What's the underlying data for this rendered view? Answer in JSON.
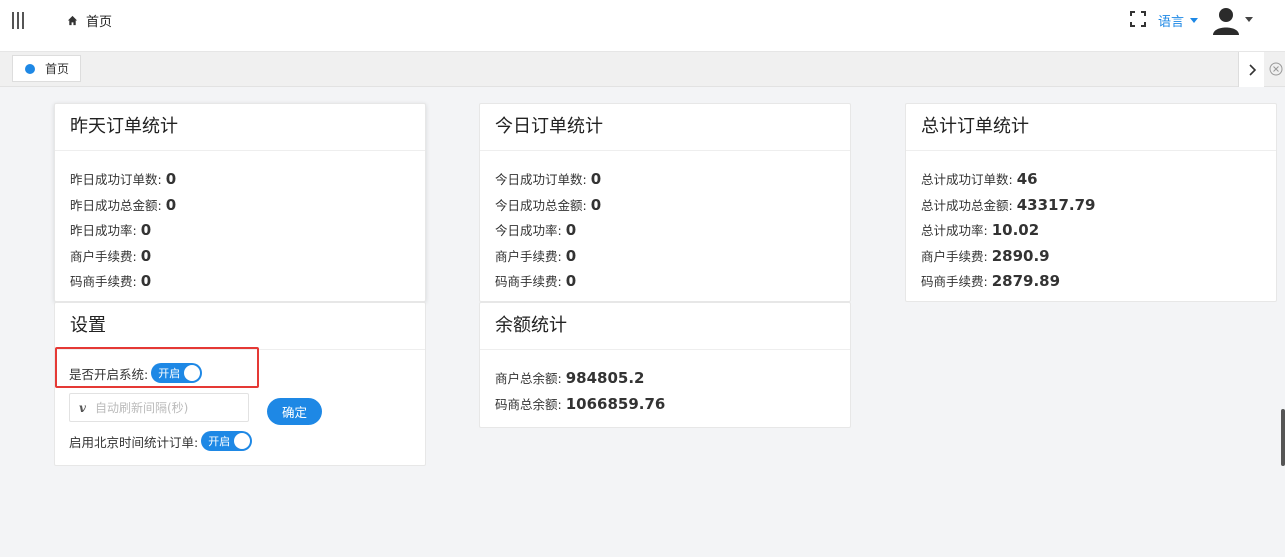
{
  "header": {
    "breadcrumb": "首页",
    "language": "语言",
    "icons": [
      "menu-toggle-icon",
      "home-icon",
      "fullscreen-icon",
      "avatar-icon"
    ]
  },
  "tabs": [
    {
      "label": "首页",
      "active": true
    }
  ],
  "colors": {
    "accent": "#1e88e5",
    "highlight": "#e53935"
  },
  "yesterday": {
    "title": "昨天订单统计",
    "rows": [
      {
        "label": "昨日成功订单数:",
        "value": "0"
      },
      {
        "label": "昨日成功总金额:",
        "value": "0"
      },
      {
        "label": "昨日成功率:",
        "value": "0"
      },
      {
        "label": "商户手续费:",
        "value": "0"
      },
      {
        "label": "码商手续费:",
        "value": "0"
      }
    ]
  },
  "today": {
    "title": "今日订单统计",
    "rows": [
      {
        "label": "今日成功订单数:",
        "value": "0"
      },
      {
        "label": "今日成功总金额:",
        "value": "0"
      },
      {
        "label": "今日成功率:",
        "value": "0"
      },
      {
        "label": "商户手续费:",
        "value": "0"
      },
      {
        "label": "码商手续费:",
        "value": "0"
      }
    ]
  },
  "total": {
    "title": "总计订单统计",
    "rows": [
      {
        "label": "总计成功订单数:",
        "value": "46"
      },
      {
        "label": "总计成功总金额:",
        "value": "43317.79"
      },
      {
        "label": "总计成功率:",
        "value": "10.02"
      },
      {
        "label": "商户手续费:",
        "value": "2890.9"
      },
      {
        "label": "码商手续费:",
        "value": "2879.89"
      }
    ]
  },
  "balance": {
    "title": "余额统计",
    "rows": [
      {
        "label": "商户总余额:",
        "value": "984805.2"
      },
      {
        "label": "码商总余额:",
        "value": "1066859.76"
      }
    ]
  },
  "settings": {
    "title": "设置",
    "enable_system_label": "是否开启系统:",
    "enable_system_switch": "开启",
    "interval_placeholder": "自动刷新间隔(秒)",
    "interval_icon": "v",
    "confirm_label": "确定",
    "beijing_time_label": "启用北京时间统计订单:",
    "beijing_time_switch": "开启"
  }
}
